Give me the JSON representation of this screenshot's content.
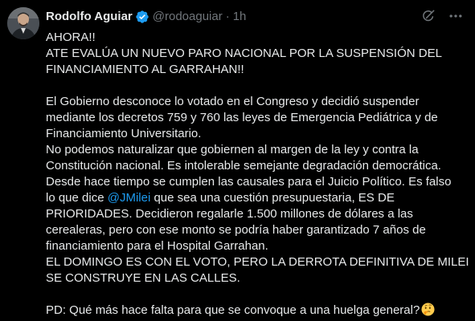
{
  "author": {
    "display_name": "Rodolfo Aguiar",
    "handle": "@rodoaguiar",
    "separator": "·",
    "timestamp": "1h",
    "verified_icon": "verified-badge-icon",
    "verified_color": "#1d9bf0"
  },
  "actions": {
    "grok_icon": "grok-icon",
    "more_icon": "more-options-icon"
  },
  "tweet": {
    "l01": "AHORA!!",
    "l02": "ATE EVALÚA UN NUEVO PARO NACIONAL POR LA SUSPENSIÓN DEL",
    "l03": "FINANCIAMIENTO AL GARRAHAN!!",
    "l05": "El Gobierno desconoce lo votado en el Congreso y decidió suspender",
    "l06": "mediante los decretos 759 y 760 las leyes de Emergencia Pediátrica y de",
    "l07": "Financiamiento Universitario.",
    "l08": "No podemos naturalizar que gobiernen al margen de la ley y contra la",
    "l09": "Constitución nacional. Es intolerable semejante degradación democrática.",
    "l10": "Desde hace tiempo se cumplen las causales para el Juicio Político. Es falso",
    "l11_pre": "lo que dice ",
    "l11_mention": "@JMilei",
    "l11_post": " que sea una cuestión presupuestaria, ES DE",
    "l12": "PRIORIDADES. Decidieron regalarle 1.500 millones de dólares a las",
    "l13": "cerealeras, pero con ese monto se podría haber garantizado 7 años de",
    "l14": "financiamiento para el Hospital Garrahan.",
    "l15": "EL DOMINGO ES CON EL VOTO, PERO LA DERROTA DEFINITIVA DE MILEI",
    "l16": "SE CONSTRUYE EN LAS CALLES.",
    "l18": "PD: Qué más hace falta para que se convoque a una huelga general?",
    "l18_emoji": "thinking-face-emoji"
  },
  "colors": {
    "background": "#000000",
    "text": "#e7e9ea",
    "muted": "#71767b",
    "link": "#1d9bf0"
  }
}
